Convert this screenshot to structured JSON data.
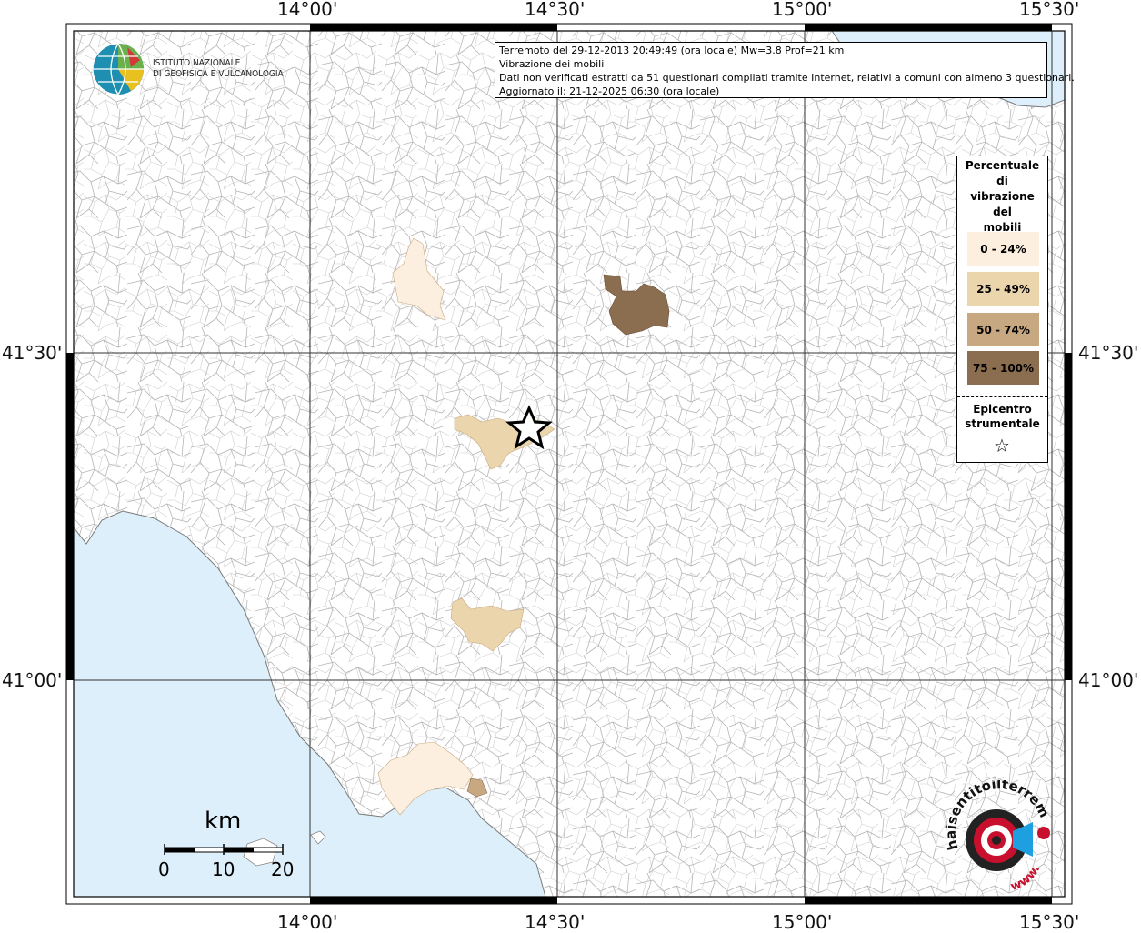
{
  "map": {
    "lon_ticks": [
      "14°00'",
      "14°30'",
      "15°00'",
      "15°30'"
    ],
    "lat_ticks": [
      "41°30'",
      "41°00'"
    ],
    "colors": {
      "sea": "#ddeffa",
      "land": "#ffffff",
      "border": "#a8a8a8",
      "grid": "#333333",
      "class1": "#fdefe0",
      "class2": "#ead5ad",
      "class3": "#c8a880",
      "class4": "#8b6d4f"
    },
    "highlighted_comuni": [
      {
        "class": "0 - 24%",
        "location": "north-west"
      },
      {
        "class": "25 - 49%",
        "location": "near epicentre"
      },
      {
        "class": "75 - 100%",
        "location": "north-east"
      },
      {
        "class": "25 - 49%",
        "location": "south"
      },
      {
        "class": "0 - 24%",
        "location": "coast south-west"
      },
      {
        "class": "50 - 74%",
        "location": "coast south-west"
      }
    ],
    "epicenter_icon": "star-icon"
  },
  "info": {
    "line1": "Terremoto del 29-12-2013 20:49:49 (ora locale) Mw=3.8 Prof=21 km",
    "line2": "Vibrazione dei mobili",
    "line3": "Dati non verificati estratti da 51 questionari compilati tramite Internet, relativi a comuni con almeno 3 questionari.",
    "line4": "Aggiornato il: 21-12-2025 06:30 (ora locale)"
  },
  "legend": {
    "title_lines": [
      "Percentuale",
      "di",
      "vibrazione",
      "del",
      "mobili"
    ],
    "classes": [
      {
        "label": "0 - 24%",
        "color": "#fdefe0"
      },
      {
        "label": "25 - 49%",
        "color": "#ead5ad"
      },
      {
        "label": "50 - 74%",
        "color": "#c8a880"
      },
      {
        "label": "75 - 100%",
        "color": "#8b6d4f"
      }
    ],
    "epicenter_lines": [
      "Epicentro",
      "strumentale"
    ],
    "epicenter_symbol": "☆"
  },
  "logo": {
    "line1": "ISTITUTO NAZIONALE",
    "line2": "DI GEOFISICA E VULCANOLOGIA"
  },
  "scale": {
    "unit": "km",
    "labels": [
      "0",
      "10",
      "20"
    ]
  },
  "hst_logo": {
    "text_top": "haisentitoilterremoto.it",
    "text_bottom": "www."
  }
}
